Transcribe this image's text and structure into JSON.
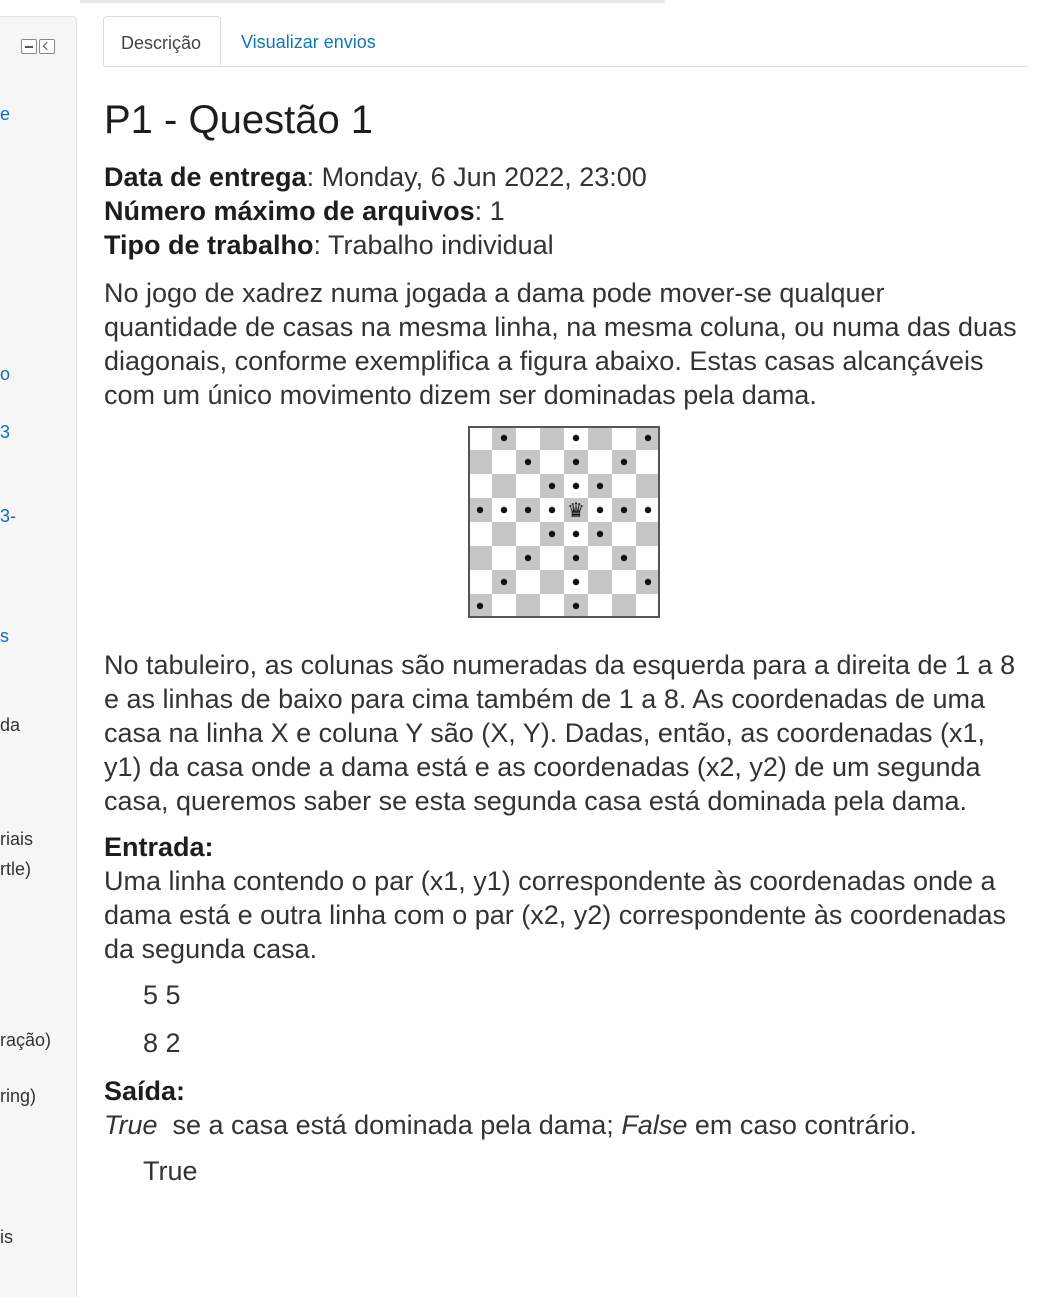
{
  "sidebar": {
    "items": [
      {
        "text": "e",
        "link": true
      },
      {
        "text": "o",
        "link": true
      },
      {
        "text": "3",
        "link": true
      },
      {
        "text": "3-",
        "link": true
      },
      {
        "text": "s",
        "link": true
      },
      {
        "text": "da",
        "link": false
      },
      {
        "text": "riais",
        "link": false
      },
      {
        "text": "rtle)",
        "link": false
      },
      {
        "text": "ração)",
        "link": false
      },
      {
        "text": "ring)",
        "link": false
      },
      {
        "text": "is",
        "link": false
      }
    ]
  },
  "tabs": [
    {
      "label": "Descrição",
      "active": true
    },
    {
      "label": "Visualizar envios",
      "active": false
    }
  ],
  "page": {
    "title": "P1 - Questão 1",
    "due_label": "Data de entrega",
    "due_value": ": Monday, 6 Jun 2022, 23:00",
    "maxfiles_label": "Número máximo de arquivos",
    "maxfiles_value": ": 1",
    "worktype_label": "Tipo de trabalho",
    "worktype_value": ": Trabalho individual",
    "intro": "No jogo de xadrez numa jogada a dama pode mover-se qualquer quantidade de casas na mesma linha, na mesma coluna, ou numa das duas diagonais, conforme exemplifica a figura abaixo. Estas casas alcançáveis com um único movimento dizem ser dominadas pela dama.",
    "explanation": "No tabuleiro, as colunas são numeradas da esquerda para a direita de 1 a 8 e as linhas de baixo para cima também de 1 a 8. As coordenadas de uma casa na linha X e coluna Y são (X, Y). Dadas, então, as coordenadas (x1, y1) da casa onde a dama está e as coordenadas (x2, y2) de um segunda casa, queremos saber se esta segunda casa está dominada pela dama.",
    "input_heading": "Entrada:",
    "input_text": "Uma linha contendo o par (x1, y1) correspondente às coordenadas onde a dama está e outra linha com o par (x2, y2) correspondente às coordenadas da segunda casa.",
    "sample_input_1": "5 5",
    "sample_input_2": "8 2",
    "output_heading": "Saída:",
    "output_true_word": "True",
    "output_mid": "  se a casa está dominada pela dama; ",
    "output_false_word": "False",
    "output_end": " em caso contrário.",
    "sample_output": "True"
  },
  "board": {
    "size": 8,
    "queen": [
      3,
      4
    ],
    "queen_glyph": "♛",
    "dots": [
      [
        0,
        1
      ],
      [
        0,
        4
      ],
      [
        0,
        7
      ],
      [
        1,
        2
      ],
      [
        1,
        4
      ],
      [
        1,
        6
      ],
      [
        2,
        3
      ],
      [
        2,
        4
      ],
      [
        2,
        5
      ],
      [
        3,
        0
      ],
      [
        3,
        1
      ],
      [
        3,
        2
      ],
      [
        3,
        3
      ],
      [
        3,
        5
      ],
      [
        3,
        6
      ],
      [
        3,
        7
      ],
      [
        4,
        3
      ],
      [
        4,
        4
      ],
      [
        4,
        5
      ],
      [
        5,
        2
      ],
      [
        5,
        4
      ],
      [
        5,
        6
      ],
      [
        6,
        1
      ],
      [
        6,
        4
      ],
      [
        6,
        7
      ],
      [
        7,
        0
      ],
      [
        7,
        4
      ]
    ],
    "light_color": "#ffffff",
    "dark_color": "#c6c6c6"
  }
}
